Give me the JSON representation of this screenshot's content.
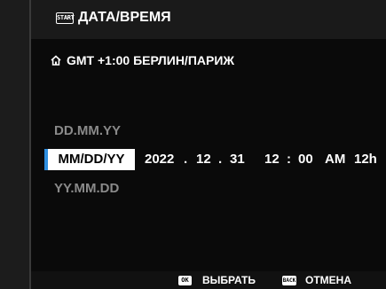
{
  "header": {
    "badge": "START",
    "title": "ДАТА/ВРЕМЯ"
  },
  "timezone": {
    "icon": "home-icon",
    "label": "GMT +1:00  БЕРЛИН/ПАРИЖ"
  },
  "date_formats": {
    "options": [
      "DD.MM.YY",
      "MM/DD/YY",
      "YY.MM.DD"
    ],
    "selected": "MM/DD/YY"
  },
  "datetime": {
    "year": "2022",
    "sep_date_1": ".",
    "month": "12",
    "sep_date_2": ".",
    "day": "31",
    "hour": "12",
    "sep_time": ":",
    "minute": "00",
    "ampm": "AM",
    "clock": "12h"
  },
  "footer": {
    "ok_key": "OK",
    "select_label": "ВЫБРАТЬ",
    "back_key": "BACK",
    "cancel_label": "ОТМЕНА"
  },
  "colors": {
    "selection_accent": "#2f8fe0",
    "inactive_text": "#8a8a8a"
  }
}
